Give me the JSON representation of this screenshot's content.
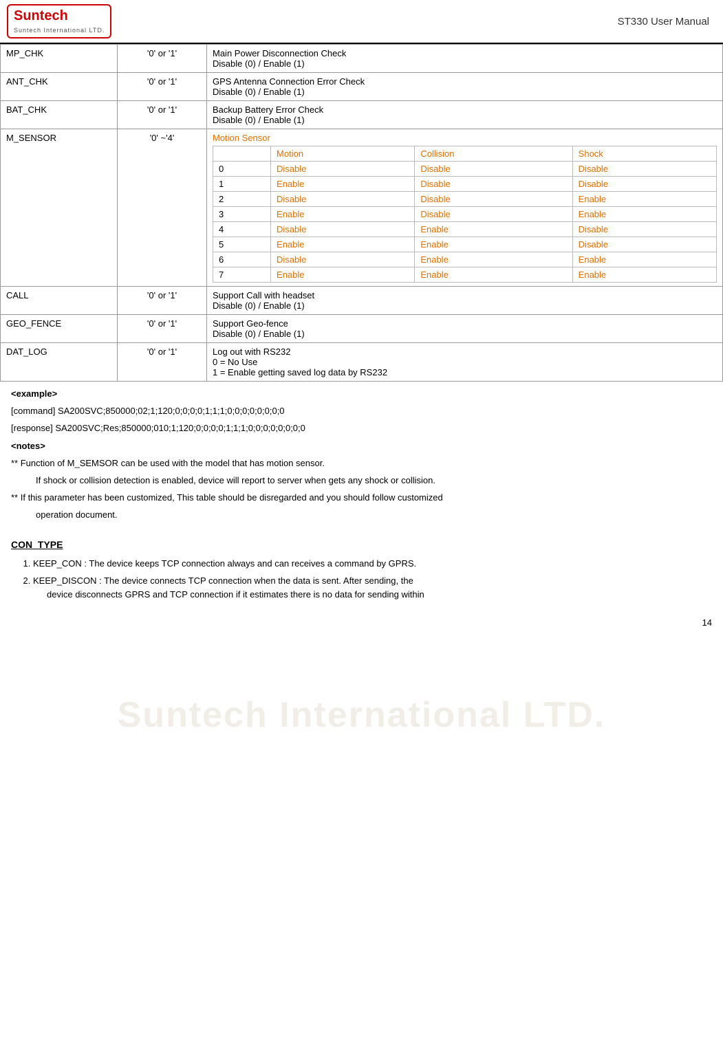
{
  "header": {
    "logo_name": "Suntech",
    "logo_subtitle": "Suntech International LTD.",
    "title": "ST330 User Manual"
  },
  "table": {
    "rows": [
      {
        "name": "MP_CHK",
        "value": "'0' or '1'",
        "desc_lines": [
          "Main Power Disconnection Check",
          "Disable (0) / Enable (1)"
        ]
      },
      {
        "name": "ANT_CHK",
        "value": "'0' or '1'",
        "desc_lines": [
          "GPS Antenna Connection Error Check",
          "Disable (0) / Enable (1)"
        ]
      },
      {
        "name": "BAT_CHK",
        "value": "'0' or '1'",
        "desc_lines": [
          "Backup Battery Error Check",
          "Disable (0) / Enable (1)"
        ]
      },
      {
        "name": "CALL",
        "value": "'0' or '1'",
        "desc_lines": [
          "Support Call with headset",
          "Disable (0) / Enable (1)"
        ]
      },
      {
        "name": "GEO_FENCE",
        "value": "'0' or '1'",
        "desc_lines": [
          "Support Geo-fence",
          "Disable (0) / Enable (1)"
        ]
      },
      {
        "name": "DAT_LOG",
        "value": "'0' or '1'",
        "desc_lines": [
          "Log out with RS232",
          "0 = No Use",
          "1 = Enable getting saved log data by RS232"
        ]
      }
    ],
    "m_sensor": {
      "name": "M_SENSOR",
      "value": "'0' ~'4'",
      "title": "Motion Sensor",
      "columns": [
        "",
        "Motion",
        "Collision",
        "Shock"
      ],
      "rows": [
        [
          "0",
          "Disable",
          "Disable",
          "Disable"
        ],
        [
          "1",
          "Enable",
          "Disable",
          "Disable"
        ],
        [
          "2",
          "Disable",
          "Disable",
          "Enable"
        ],
        [
          "3",
          "Enable",
          "Disable",
          "Enable"
        ],
        [
          "4",
          "Disable",
          "Enable",
          "Disable"
        ],
        [
          "5",
          "Enable",
          "Enable",
          "Disable"
        ],
        [
          "6",
          "Disable",
          "Enable",
          "Enable"
        ],
        [
          "7",
          "Enable",
          "Enable",
          "Enable"
        ]
      ]
    }
  },
  "example": {
    "label": "<example>",
    "command_label": "[command]",
    "command_value": "SA200SVC;850000;02;1;120;0;0;0;0;1;1;1;0;0;0;0;0;0;0;0",
    "response_label": "[response]",
    "response_value": "SA200SVC;Res;850000;010;1;120;0;0;0;0;1;1;1;0;0;0;0;0;0;0;0"
  },
  "notes": {
    "label": "<notes>",
    "note1": "** Function of M_SEMSOR can be used with the model that has motion sensor.",
    "note1b": "If shock or collision detection is enabled, device will report to server when gets any shock or collision.",
    "note2": "**  If  this  parameter  has  been  customized,  This  table  should  be  disregarded  and  you  should  follow customized",
    "note2b": "operation document."
  },
  "con_type": {
    "title": "CON_TYPE",
    "items": [
      {
        "label": "KEEP_CON : The device keeps TCP connection always and can receives a command by GPRS."
      },
      {
        "label": "KEEP_DISCON : The device connects TCP connection when the data is sent. After sending, the",
        "sub": "device disconnects GPRS and TCP connection if it estimates there is no data for sending within"
      }
    ]
  },
  "watermark": "Suntech International LTD.",
  "page_number": "14"
}
